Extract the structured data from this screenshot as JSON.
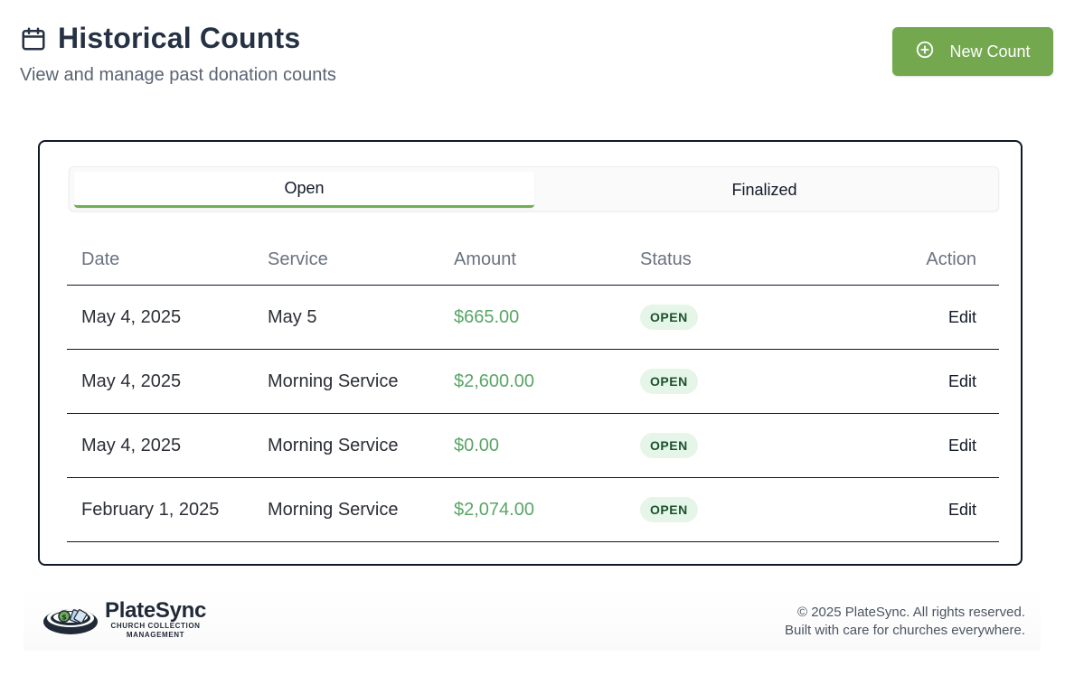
{
  "header": {
    "title": "Historical Counts",
    "subtitle": "View and manage past donation counts",
    "icon": "calendar-icon"
  },
  "new_count_button": {
    "label": "New Count",
    "icon": "plus-circle-icon"
  },
  "tabs": [
    {
      "label": "Open",
      "active": true
    },
    {
      "label": "Finalized",
      "active": false
    }
  ],
  "table": {
    "columns": [
      "Date",
      "Service",
      "Amount",
      "Status",
      "Action"
    ],
    "rows": [
      {
        "date": "May 4, 2025",
        "service": "May 5",
        "amount": "$665.00",
        "status": "OPEN",
        "action": "Edit"
      },
      {
        "date": "May 4, 2025",
        "service": "Morning Service",
        "amount": "$2,600.00",
        "status": "OPEN",
        "action": "Edit"
      },
      {
        "date": "May 4, 2025",
        "service": "Morning Service",
        "amount": "$0.00",
        "status": "OPEN",
        "action": "Edit"
      },
      {
        "date": "February 1, 2025",
        "service": "Morning Service",
        "amount": "$2,074.00",
        "status": "OPEN",
        "action": "Edit"
      }
    ]
  },
  "footer": {
    "brand_name": "PlateSync",
    "brand_tagline_1": "CHURCH COLLECTION",
    "brand_tagline_2": "MANAGEMENT",
    "copyright": "© 2025 PlateSync. All rights reserved.",
    "note": "Built with care for churches everywhere."
  },
  "colors": {
    "accent": "#74a84f",
    "tab_underline": "#6fae55",
    "amount": "#5aa566",
    "badge_bg": "#e5f6e8",
    "badge_text": "#1b5131"
  }
}
